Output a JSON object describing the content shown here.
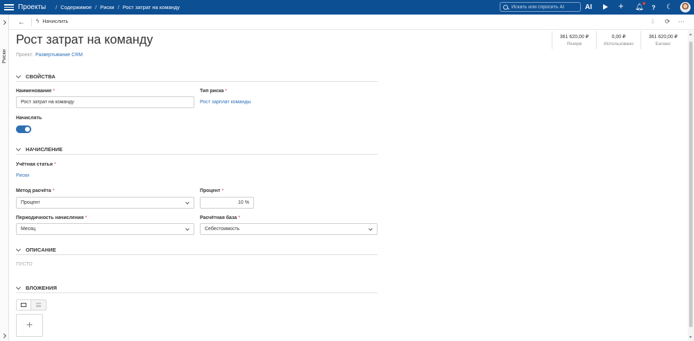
{
  "app": {
    "title": "Проекты"
  },
  "breadcrumbs": [
    "Содержимое",
    "Риски",
    "Рост затрат на команду"
  ],
  "search": {
    "placeholder": "Искать или спросить AI"
  },
  "topbar": {
    "ai_label": "AI",
    "help_label": "?",
    "moon_glyph": "☾",
    "bell_glyph": "🔔︎"
  },
  "rail": {
    "label": "Риски"
  },
  "toolbar": {
    "back_glyph": "←",
    "accrue_label": "Начислить",
    "bolt_glyph": "ϟ",
    "more_glyph": "···",
    "refresh_glyph": "⟳",
    "export_glyph": "⇩"
  },
  "header": {
    "title": "Рост затрат на команду",
    "project_label": "Проект:",
    "project_link": "Развертывание CRM"
  },
  "stats": [
    {
      "value": "361 620,00 ₽",
      "label": "Резерв"
    },
    {
      "value": "0,00 ₽",
      "label": "Использовано"
    },
    {
      "value": "361 620,00 ₽",
      "label": "Баланс"
    }
  ],
  "sections": {
    "properties": "СВОЙСТВА",
    "accrual": "НАЧИСЛЕНИЕ",
    "description": "ОПИСАНИЕ",
    "attachments": "ВЛОЖЕНИЯ"
  },
  "fields": {
    "name": {
      "label": "Наименование",
      "value": "Рост затрат на команду"
    },
    "risk_type": {
      "label": "Тип риска",
      "value": "Рост зарплат команды"
    },
    "accrue": {
      "label": "Начислять",
      "enabled": true
    },
    "account": {
      "label": "Учётная статья",
      "value": "Риски"
    },
    "calc_method": {
      "label": "Метод расчёта",
      "value": "Процент"
    },
    "percent": {
      "label": "Процент",
      "value": "10 %"
    },
    "periodicity": {
      "label": "Периодичность начисления",
      "value": "Месяц"
    },
    "calc_base": {
      "label": "Расчётная база",
      "value": "Себестоимость"
    }
  },
  "description": {
    "empty_text": "ПУСТО"
  },
  "attachments": {
    "add_glyph": "+"
  },
  "required_mark": "*"
}
